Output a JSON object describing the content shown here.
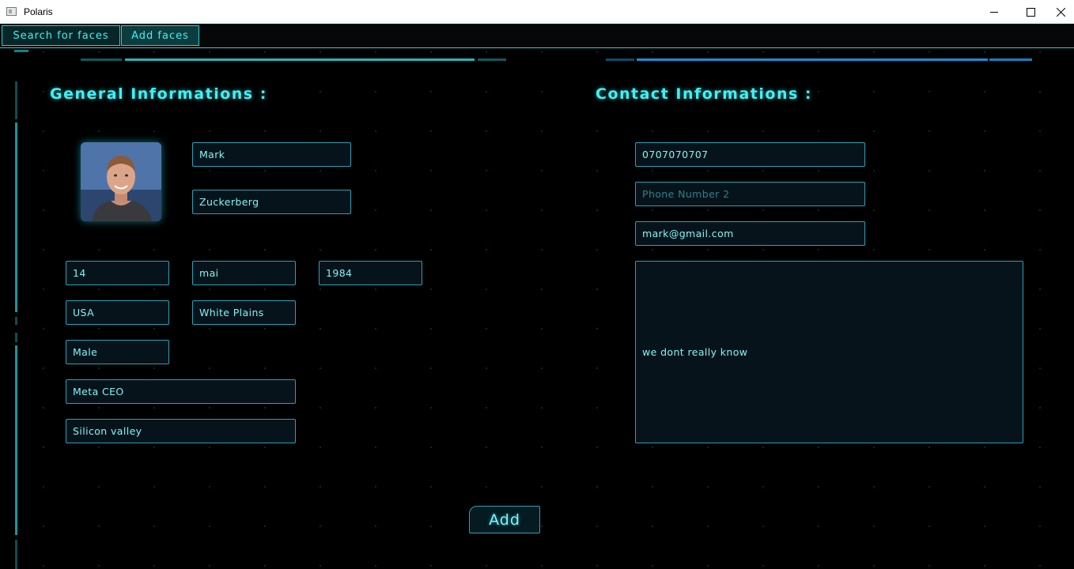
{
  "window": {
    "title": "Polaris"
  },
  "tabs": [
    {
      "label": "Search for faces"
    },
    {
      "label": "Add faces"
    }
  ],
  "general": {
    "heading": "General Informations :",
    "first_name": "Mark",
    "last_name": "Zuckerberg",
    "birth_day": "14",
    "birth_month": "mai",
    "birth_year": "1984",
    "country": "USA",
    "city": "White Plains",
    "gender": "Male",
    "occupation": "Meta CEO",
    "address": "Silicon valley"
  },
  "contact": {
    "heading": "Contact Informations :",
    "phone1": "0707070707",
    "phone2_placeholder": "Phone Number 2",
    "email": "mark@gmail.com",
    "notes": "we dont really know"
  },
  "actions": {
    "add_label": "Add"
  },
  "colors": {
    "accent": "#1fd3d8",
    "text": "#7ff4f6",
    "field_border": "#2aa0b4",
    "background": "#000000"
  }
}
